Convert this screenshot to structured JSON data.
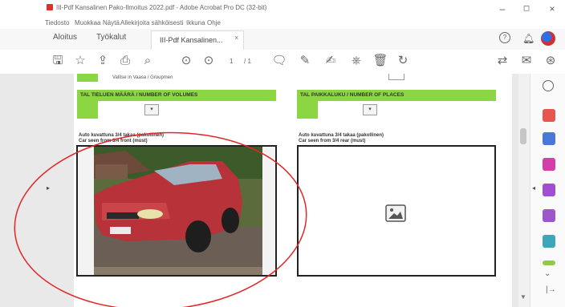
{
  "window": {
    "title": "III-Pdf Kansalinen Pako-Ilmoitus 2022.pdf - Adobe Acrobat Pro DC (32-bit)",
    "minimize": "–",
    "maximize": "◻",
    "close": "×"
  },
  "menubar": [
    "Tiedosto",
    "Muokkaa",
    "Näytä",
    "Allekirjoita sähköisesti",
    "Ikkuna",
    "Ohje"
  ],
  "tabs": {
    "home": "Aloitus",
    "tools": "Työkalut",
    "document": "III-Pdf Kansalinen...",
    "close": "×"
  },
  "toolbar": {
    "page_current": "1",
    "page_sep": "/ 1"
  },
  "form": {
    "top_caption": "Valitse in Vaasa / Groupmen",
    "section_left": "TAL    TIELUEN MÄÄRÄ / NUMBER OF VOLUMES",
    "section_right": "TAL    PAIKKALUKU / NUMBER OF PLACES",
    "dropdown_symbol": "▾",
    "photo_caption_left_1": "Auto kuvattuna 3/4 takaa (pakollinen)",
    "photo_caption_left_2": "Car seen from 3/4 front (must)",
    "photo_caption_right_1": "Auto kuvattuna 3/4 takaa (pakollinen)",
    "photo_caption_right_2": "Car seen from 3/4 rear (must)"
  },
  "colors": {
    "form_green": "#8dd643",
    "annotation_red": "#e32626"
  },
  "icons": [
    "save-icon",
    "star-icon",
    "upload-icon",
    "print-icon",
    "zoom-icon",
    "prev-page-icon",
    "next-page-icon",
    "comment-icon",
    "pen-icon",
    "sign-icon",
    "stamp-icon",
    "delete-icon",
    "rotate-icon",
    "share-icon",
    "mail-icon",
    "profile-icon"
  ]
}
